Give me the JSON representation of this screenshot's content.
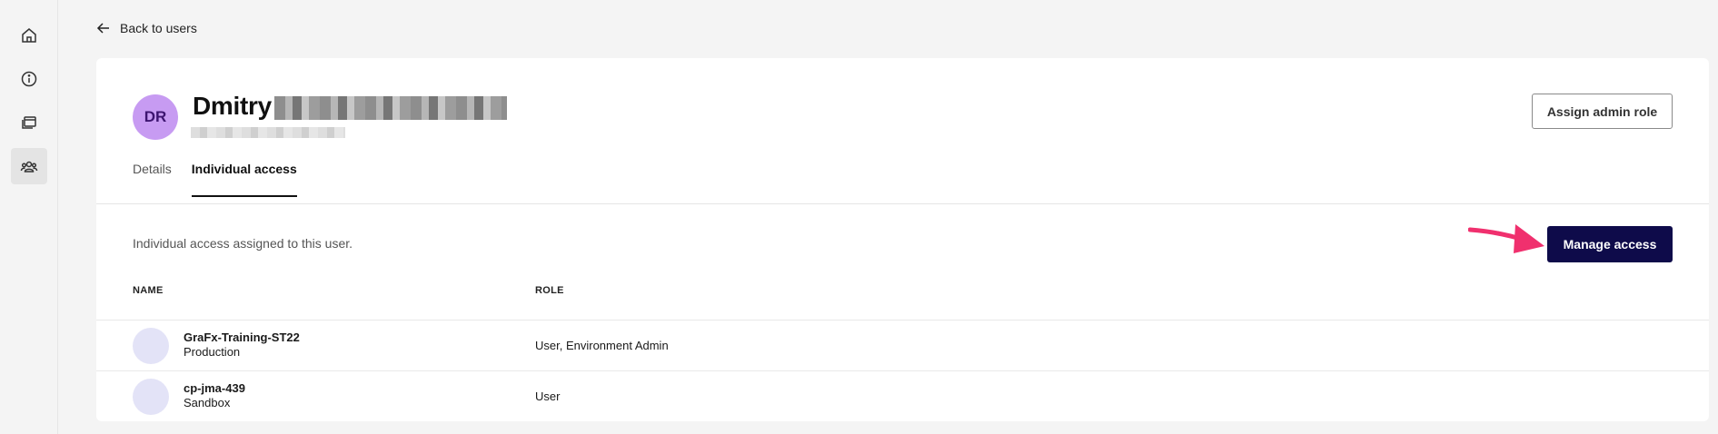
{
  "nav": {
    "items": [
      {
        "icon": "home-icon",
        "active": false
      },
      {
        "icon": "info-icon",
        "active": false
      },
      {
        "icon": "windows-icon",
        "active": false
      },
      {
        "icon": "users-icon",
        "active": true
      }
    ]
  },
  "header": {
    "back_label": "Back to users"
  },
  "user": {
    "initials": "DR",
    "first_name": "Dmitry",
    "avatar_color": "#c79bf2",
    "assign_admin_label": "Assign admin role"
  },
  "tabs": [
    {
      "label": "Details",
      "active": false
    },
    {
      "label": "Individual access",
      "active": true
    }
  ],
  "access": {
    "description": "Individual access assigned to this user.",
    "manage_label": "Manage access",
    "manage_color": "#0e0b4a",
    "annotation_arrow_color": "#f0306e",
    "columns": {
      "name": "NAME",
      "role": "ROLE"
    },
    "rows": [
      {
        "name": "GraFx-Training-ST22",
        "environment": "Production",
        "role": "User, Environment Admin"
      },
      {
        "name": "cp-jma-439",
        "environment": "Sandbox",
        "role": "User"
      }
    ]
  }
}
